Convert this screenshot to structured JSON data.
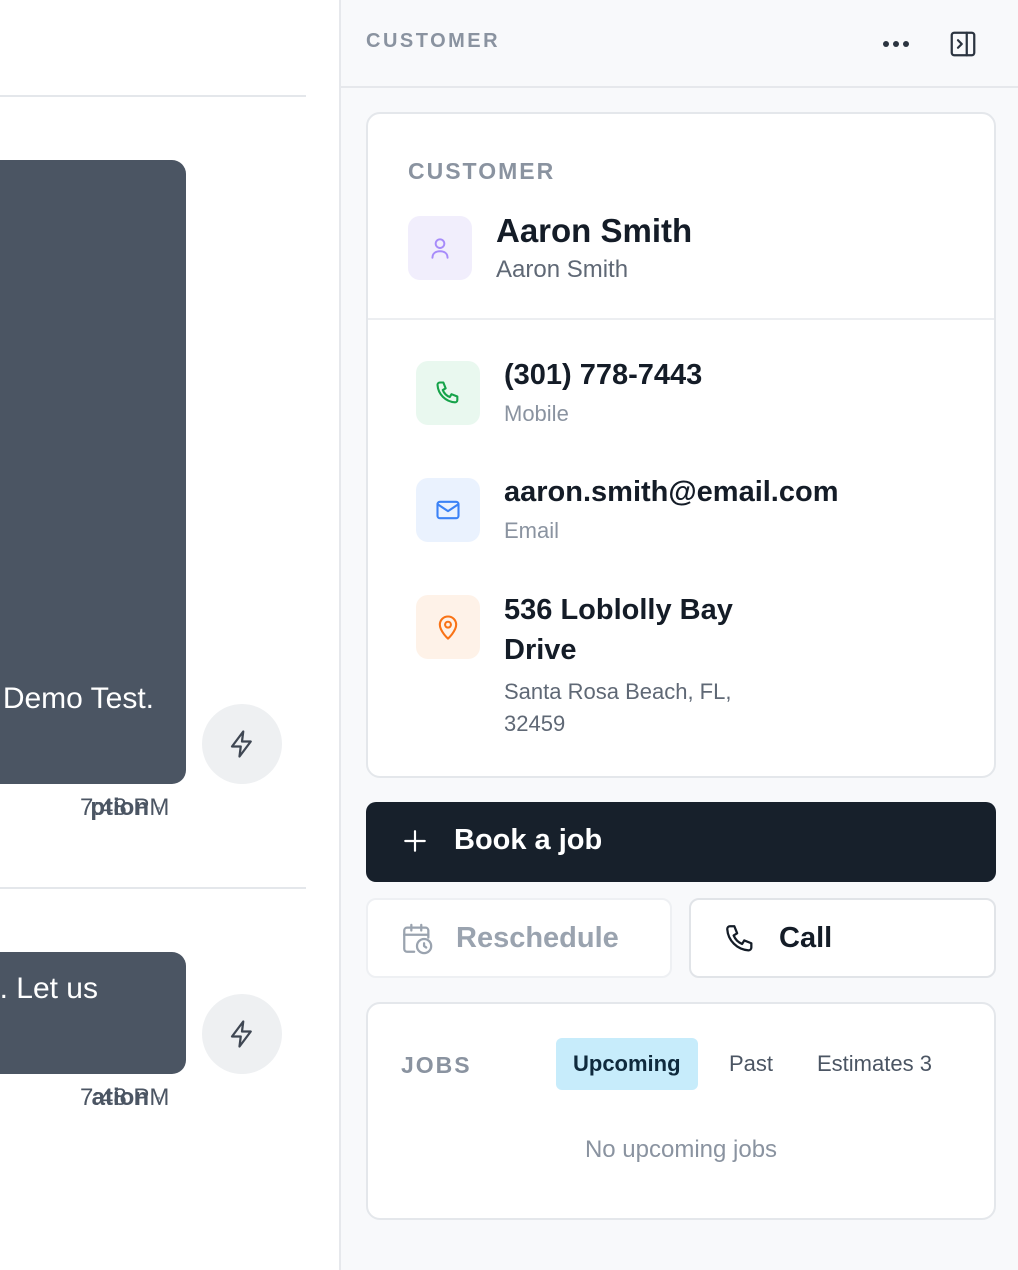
{
  "chat": {
    "messages": [
      {
        "text": "Demo Test.",
        "source": "ption",
        "time": "7:48 PM"
      },
      {
        "text": ". Let us",
        "source": "ation",
        "time": "7:48 PM"
      }
    ]
  },
  "panel": {
    "header_title": "CUSTOMER",
    "customer": {
      "section_label": "CUSTOMER",
      "name": "Aaron Smith",
      "subname": "Aaron Smith",
      "phone": {
        "value": "(301) 778-7443",
        "label": "Mobile"
      },
      "email": {
        "value": "aaron.smith@email.com",
        "label": "Email"
      },
      "address": {
        "line1": "536 Loblolly Bay",
        "line2": "Drive",
        "city_line": "Santa Rosa Beach, FL,",
        "zip_line": "32459"
      }
    },
    "actions": {
      "book_label": "Book a job",
      "reschedule_label": "Reschedule",
      "call_label": "Call"
    },
    "jobs": {
      "section_label": "JOBS",
      "tabs": [
        {
          "label": "Upcoming",
          "active": true
        },
        {
          "label": "Past",
          "active": false
        },
        {
          "label": "Estimates 3",
          "active": false
        }
      ],
      "empty_text": "No upcoming jobs"
    }
  },
  "colors": {
    "accent_dark": "#17202b",
    "tab_active_bg": "#c7ecfb",
    "bubble_bg": "#4b5563",
    "phone_icon": "#16a34a",
    "email_icon": "#3b82f6",
    "location_icon": "#f97316",
    "avatar_icon": "#a78bfa"
  }
}
